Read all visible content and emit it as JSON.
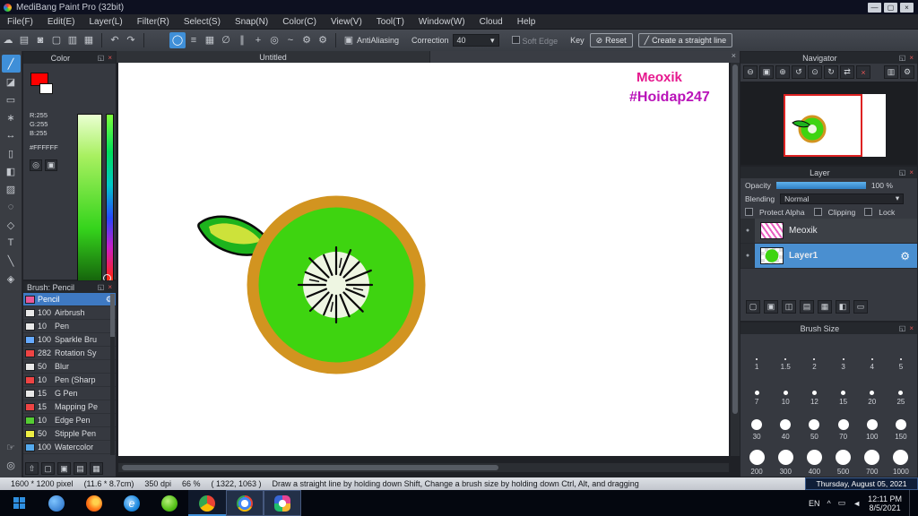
{
  "window": {
    "title": "MediBang Paint Pro (32bit)"
  },
  "icons": {
    "minimize": "—",
    "maximize": "▢",
    "close": "×",
    "popout": "◱",
    "panel_close": "×",
    "cloud": "☁",
    "save": "▤",
    "chat": "◙",
    "doc": "▢",
    "stack": "▥",
    "grid": "▦",
    "undo": "↶",
    "redo": "↷",
    "brush_round": "◯",
    "lines": "≡",
    "snap_off": "∅",
    "snap_parallel": "∥",
    "snap_cross": "+",
    "snap_radial": "◎",
    "snap_curve": "~",
    "gear": "⚙",
    "antialias": "▣",
    "reset_slash": "⊘",
    "line_diag": "╱",
    "zoom_out": "⊖",
    "zoom_fit": "▣",
    "zoom_in": "⊕",
    "rot_ccw": "↺",
    "rot_reset": "⊙",
    "rot_cw": "↻",
    "flip": "⇄",
    "close_red": "×",
    "caret_down": "▾",
    "eye": "●",
    "pen_tool": "╱",
    "eraser_tool": "◪",
    "select_tool": "▭",
    "wand_tool": "∗",
    "move_tool": "↔",
    "rect_tool": "▯",
    "bucket_tool": "◧",
    "gradient_tool": "▨",
    "lasso_tool": "◌",
    "shape_tool": "◇",
    "text_tool": "T",
    "eyedrop_tool": "╲",
    "hand_tool": "☞",
    "zoom_tool": "◎",
    "divide_tool": "◈",
    "layer_new": "▢",
    "layer_dup": "▣",
    "layer_up": "◫",
    "layer_folder": "▤",
    "layer_merge": "▦",
    "layer_conv": "◧",
    "layer_del": "▭",
    "brush_up": "⇧",
    "brush_new": "▢",
    "brush_dup": "▣",
    "brush_folder": "▤",
    "brush_del": "▦",
    "tray_caret": "^",
    "tray_kbd": "▭",
    "tray_vol": "◄"
  },
  "menu": {
    "items": [
      "File(F)",
      "Edit(E)",
      "Layer(L)",
      "Filter(R)",
      "Select(S)",
      "Snap(N)",
      "Color(C)",
      "View(V)",
      "Tool(T)",
      "Window(W)",
      "Cloud",
      "Help"
    ]
  },
  "toolbar": {
    "antialiasing_label": "AntiAliasing",
    "correction_label": "Correction",
    "correction_value": "40",
    "soft_edge_label": "Soft Edge",
    "key_label": "Key",
    "reset_label": "Reset",
    "straight_line_label": "Create a straight line"
  },
  "color_panel": {
    "title": "Color",
    "r": "R:255",
    "g": "G:255",
    "b": "B:255",
    "hex": "#FFFFFF",
    "foreground": "#FF0000",
    "background": "#FFFFFF"
  },
  "brush_panel": {
    "title": "Brush: Pencil",
    "selected_name": "Pencil",
    "selected_color": "#e85898",
    "items": [
      {
        "size": "100",
        "name": "Airbrush",
        "color": "#e8e8e8"
      },
      {
        "size": "10",
        "name": "Pen",
        "color": "#e8e8e8"
      },
      {
        "size": "100",
        "name": "Sparkle Bru",
        "color": "#66aaff"
      },
      {
        "size": "282",
        "name": "Rotation Sy",
        "color": "#ee4444"
      },
      {
        "size": "50",
        "name": "Blur",
        "color": "#e8e8e8"
      },
      {
        "size": "10",
        "name": "Pen (Sharp",
        "color": "#ee4444"
      },
      {
        "size": "15",
        "name": "G Pen",
        "color": "#e8e8e8"
      },
      {
        "size": "15",
        "name": "Mapping Pe",
        "color": "#ee4444"
      },
      {
        "size": "10",
        "name": "Edge Pen",
        "color": "#55cc33"
      },
      {
        "size": "50",
        "name": "Stipple Pen",
        "color": "#eeee44"
      },
      {
        "size": "100",
        "name": "Watercolor",
        "color": "#55aaee"
      }
    ]
  },
  "canvas": {
    "tab": "Untitled",
    "watermark_line1": "Meoxik",
    "watermark_line2": "#Hoidap247",
    "kiwi_green": "#3ed410",
    "kiwi_ring": "#d29420"
  },
  "navigator": {
    "title": "Navigator"
  },
  "layer_panel": {
    "title": "Layer",
    "opacity_label": "Opacity",
    "opacity_value": "100 %",
    "blending_label": "Blending",
    "blending_value": "Normal",
    "protect_alpha_label": "Protect Alpha",
    "clipping_label": "Clipping",
    "lock_label": "Lock",
    "layers": [
      {
        "name": "Meoxik"
      },
      {
        "name": "Layer1"
      }
    ]
  },
  "brush_size_panel": {
    "title": "Brush Size",
    "sizes": [
      "1",
      "1.5",
      "2",
      "3",
      "4",
      "5",
      "7",
      "10",
      "12",
      "15",
      "20",
      "25",
      "30",
      "40",
      "50",
      "70",
      "100",
      "150",
      "200",
      "300",
      "400",
      "500",
      "700",
      "1000"
    ]
  },
  "status_bar": {
    "dimensions": "1600 * 1200 pixel",
    "physical": "(11.6 * 8.7cm)",
    "dpi": "350 dpi",
    "zoom": "66 %",
    "coords": "( 1322, 1063 )",
    "hint": "Draw a straight line by holding down Shift, Change a brush size by holding down Ctrl, Alt, and dragging",
    "date_banner": "Thursday, August 05, 2021"
  },
  "taskbar": {
    "language": "EN",
    "time": "12:11 PM",
    "date": "8/5/2021"
  },
  "colors": {
    "accent": "#3f8fd8",
    "selected_layer": "#4a8fd0",
    "watermark_pink": "#e6188e",
    "watermark_purple": "#b913b9"
  }
}
